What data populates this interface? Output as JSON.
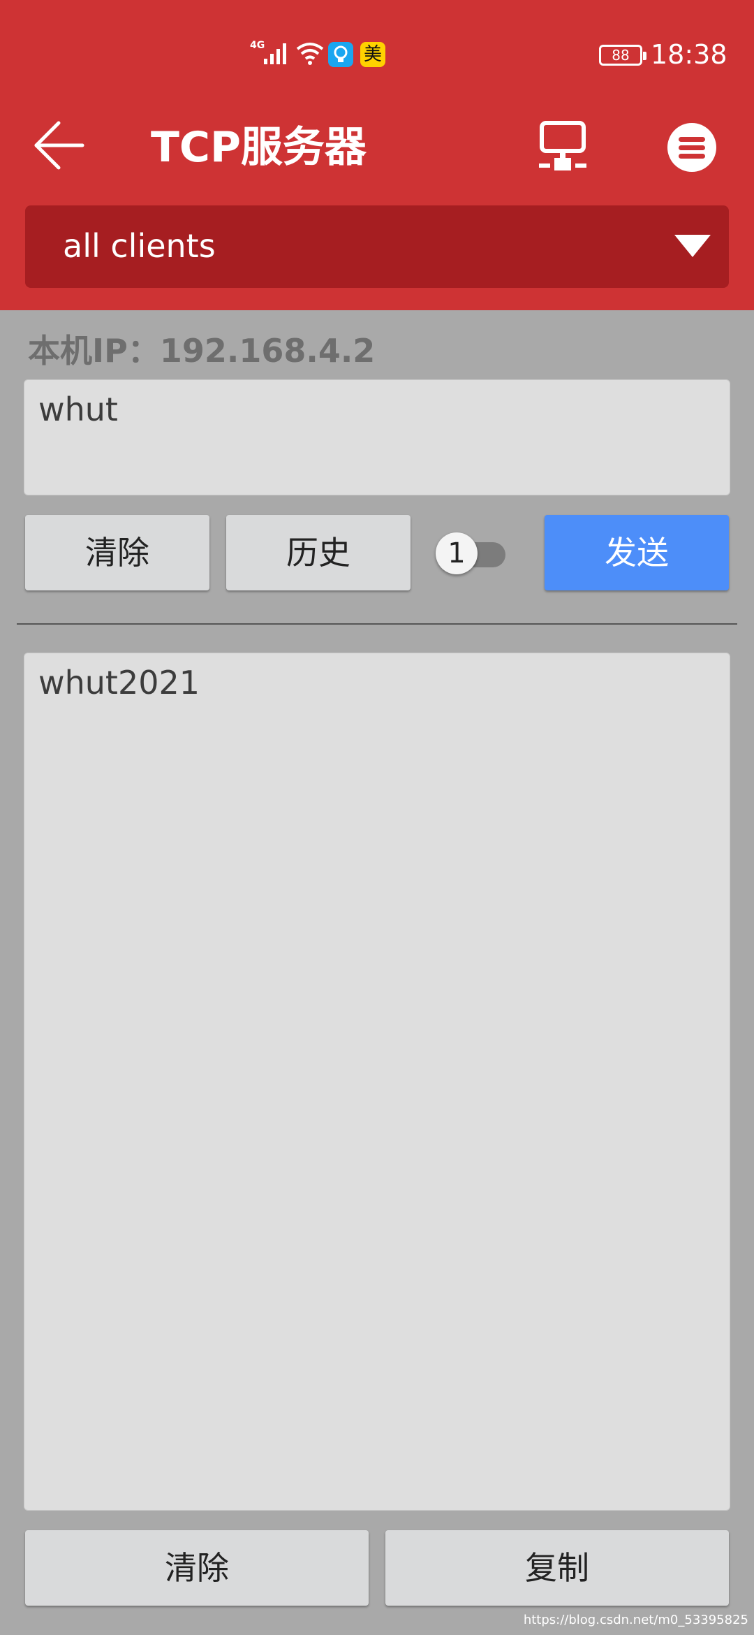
{
  "status_bar": {
    "network": "4G",
    "yellow_app_glyph": "美",
    "battery": "88",
    "time": "18:38"
  },
  "app_bar": {
    "title": "TCP服务器",
    "icons": {
      "back": "arrow-left-icon",
      "network": "network-monitor-icon",
      "menu": "menu-icon"
    }
  },
  "client_select": {
    "selected": "all clients"
  },
  "local_ip_label": "本机IP：192.168.4.2",
  "send_input": {
    "value": "whut"
  },
  "send_controls": {
    "clear_label": "清除",
    "history_label": "历史",
    "toggle_label": "1",
    "send_label": "发送"
  },
  "receive_area": {
    "content": "whut2021"
  },
  "bottom_controls": {
    "clear_label": "清除",
    "copy_label": "复制"
  },
  "watermark": "https://blog.csdn.net/m0_53395825",
  "colors": {
    "header": "#ce3334",
    "dropdown": "#a61e21",
    "background": "#a9a9a9",
    "send_button": "#4d8ef9"
  }
}
